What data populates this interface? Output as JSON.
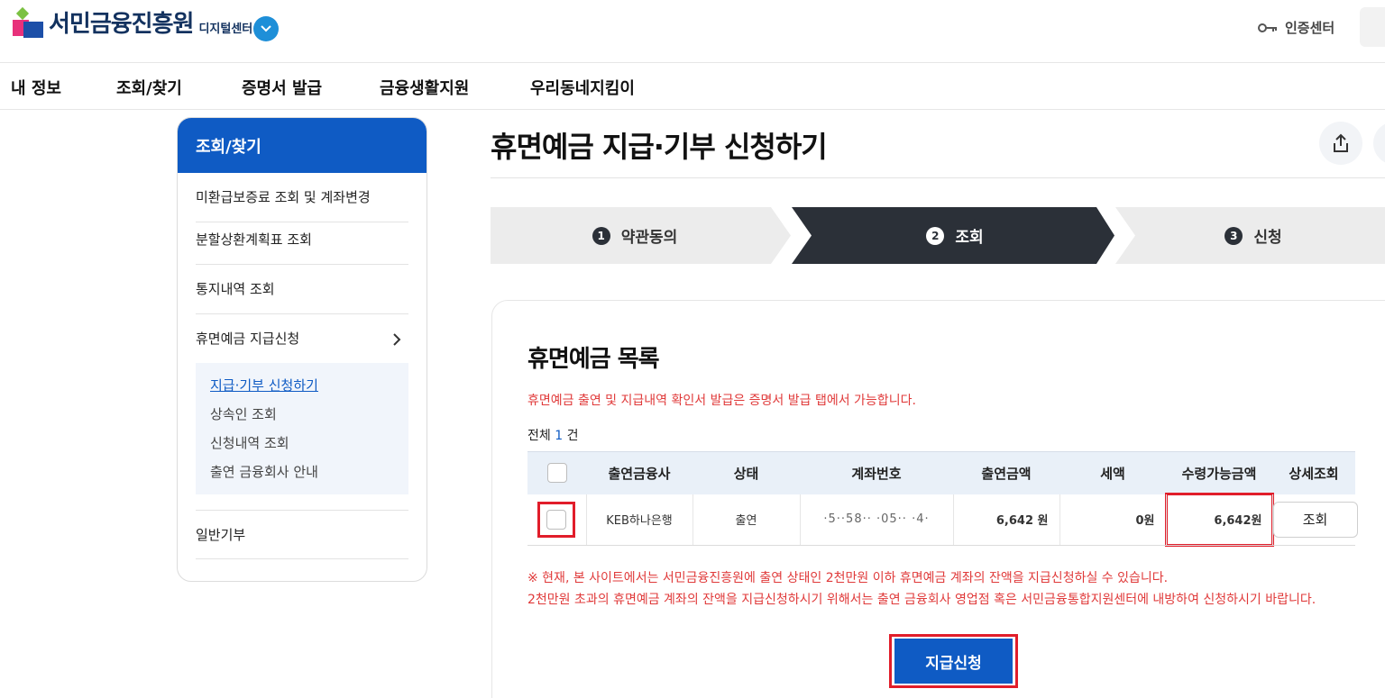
{
  "header": {
    "logo_text": "서민금융진흥원",
    "logo_sub": "디지털센터",
    "cert_label": "인증센터"
  },
  "gnb": [
    "내 정보",
    "조회/찾기",
    "증명서 발급",
    "금융생활지원",
    "우리동네지킴이"
  ],
  "sidebar": {
    "title": "조회/찾기",
    "items": [
      "미환급보증료 조회 및 계좌변경",
      "분할상환계획표 조회",
      "통지내역 조회",
      "휴면예금 지급신청",
      "일반기부"
    ],
    "sub_items": [
      "지급·기부 신청하기",
      "상속인 조회",
      "신청내역 조회",
      "출연 금융회사 안내"
    ]
  },
  "page": {
    "title": "휴면예금 지급·기부 신청하기"
  },
  "steps": [
    {
      "num": "1",
      "label": "약관동의"
    },
    {
      "num": "2",
      "label": "조회"
    },
    {
      "num": "3",
      "label": "신청"
    }
  ],
  "list": {
    "title": "휴면예금 목록",
    "notice": "휴면예금 출연 및 지급내역 확인서 발급은 증명서 발급 탭에서 가능합니다.",
    "total_prefix": "전체",
    "total_count": "1",
    "total_suffix": "건",
    "columns": [
      "출연금융사",
      "상태",
      "계좌번호",
      "출연금액",
      "세액",
      "수령가능금액",
      "상세조회"
    ],
    "rows": [
      {
        "bank": "KEB하나은행",
        "status": "출연",
        "account": "·5··58·· ·05·· ·4·",
        "amount": "6,642 원",
        "tax": "0원",
        "receivable": "6,642원",
        "detail_label": "조회"
      }
    ],
    "notice2_line1": "※ 현재, 본 사이트에서는 서민금융진흥원에 출연 상태인 2천만원 이하 휴면예금 계좌의 잔액을 지급신청하실 수 있습니다.",
    "notice2_line2": "2천만원 초과의 휴면예금 계좌의 잔액을 지급신청하시기 위해서는 출연 금융회사 영업점 혹은 서민금융통합지원센터에 내방하여 신청하시기 바랍니다.",
    "submit_label": "지급신청"
  },
  "colors": {
    "brand_blue": "#0f5bc4",
    "highlight_red": "#e11d2a",
    "notice_red": "#e03a3a",
    "step_active": "#2b3038"
  }
}
